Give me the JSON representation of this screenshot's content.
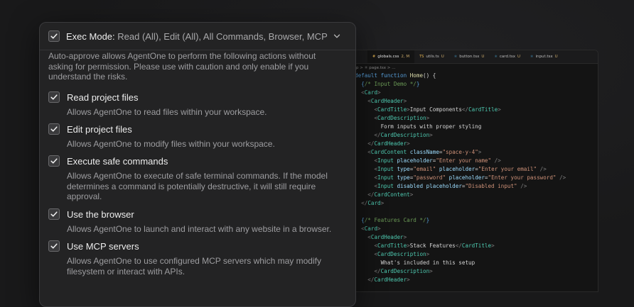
{
  "editor": {
    "tabs": [
      {
        "name": "globals.css",
        "status": "2, M",
        "type": "css"
      },
      {
        "name": "utils.ts",
        "status": "U",
        "type": "ts"
      },
      {
        "name": "button.tsx",
        "status": "U",
        "type": "tsx"
      },
      {
        "name": "card.tsx",
        "status": "U",
        "type": "tsx"
      },
      {
        "name": "input.tsx",
        "status": "U",
        "type": "tsx"
      }
    ],
    "breadcrumb": "p > ⚛ page.tsx > …",
    "code_lines": [
      "default function Home() {",
      "  {/* Input Demo */}",
      "  <Card>",
      "    <CardHeader>",
      "      <CardTitle>Input Components</CardTitle>",
      "      <CardDescription>",
      "        Form inputs with proper styling",
      "      </CardDescription>",
      "    </CardHeader>",
      "    <CardContent className=\"space-y-4\">",
      "      <Input placeholder=\"Enter your name\" />",
      "      <Input type=\"email\" placeholder=\"Enter your email\" />",
      "      <Input type=\"password\" placeholder=\"Enter your password\" />",
      "      <Input disabled placeholder=\"Disabled input\" />",
      "    </CardContent>",
      "  </Card>",
      "",
      "  {/* Features Card */}",
      "  <Card>",
      "    <CardHeader>",
      "      <CardTitle>Stack Features</CardTitle>",
      "      <CardDescription>",
      "        What's included in this setup",
      "      </CardDescription>",
      "    </CardHeader>"
    ]
  },
  "panel": {
    "exec_label": "Exec Mode:",
    "exec_value": "Read (All), Edit (All), All Commands, Browser, MCP",
    "description": "Auto-approve allows AgentOne to perform the following actions without asking for permission. Please use with caution and only enable if you understand the risks.",
    "options": [
      {
        "title": "Read project files",
        "desc": "Allows AgentOne to read files within your workspace.",
        "checked": true
      },
      {
        "title": "Edit project files",
        "desc": "Allows AgentOne to modify files within your workspace.",
        "checked": true
      },
      {
        "title": "Execute safe commands",
        "desc": "Allows AgentOne to execute of safe terminal commands. If the model determines a command is potentially destructive, it will still require approval.",
        "checked": true
      },
      {
        "title": "Use the browser",
        "desc": "Allows AgentOne to launch and interact with any website in a browser.",
        "checked": true
      },
      {
        "title": "Use MCP servers",
        "desc": "Allows AgentOne to use configured MCP servers which may modify filesystem or interact with APIs.",
        "checked": true
      }
    ]
  },
  "colors": {
    "background": "#19191a",
    "panel": "#232324",
    "editor": "#141414"
  }
}
